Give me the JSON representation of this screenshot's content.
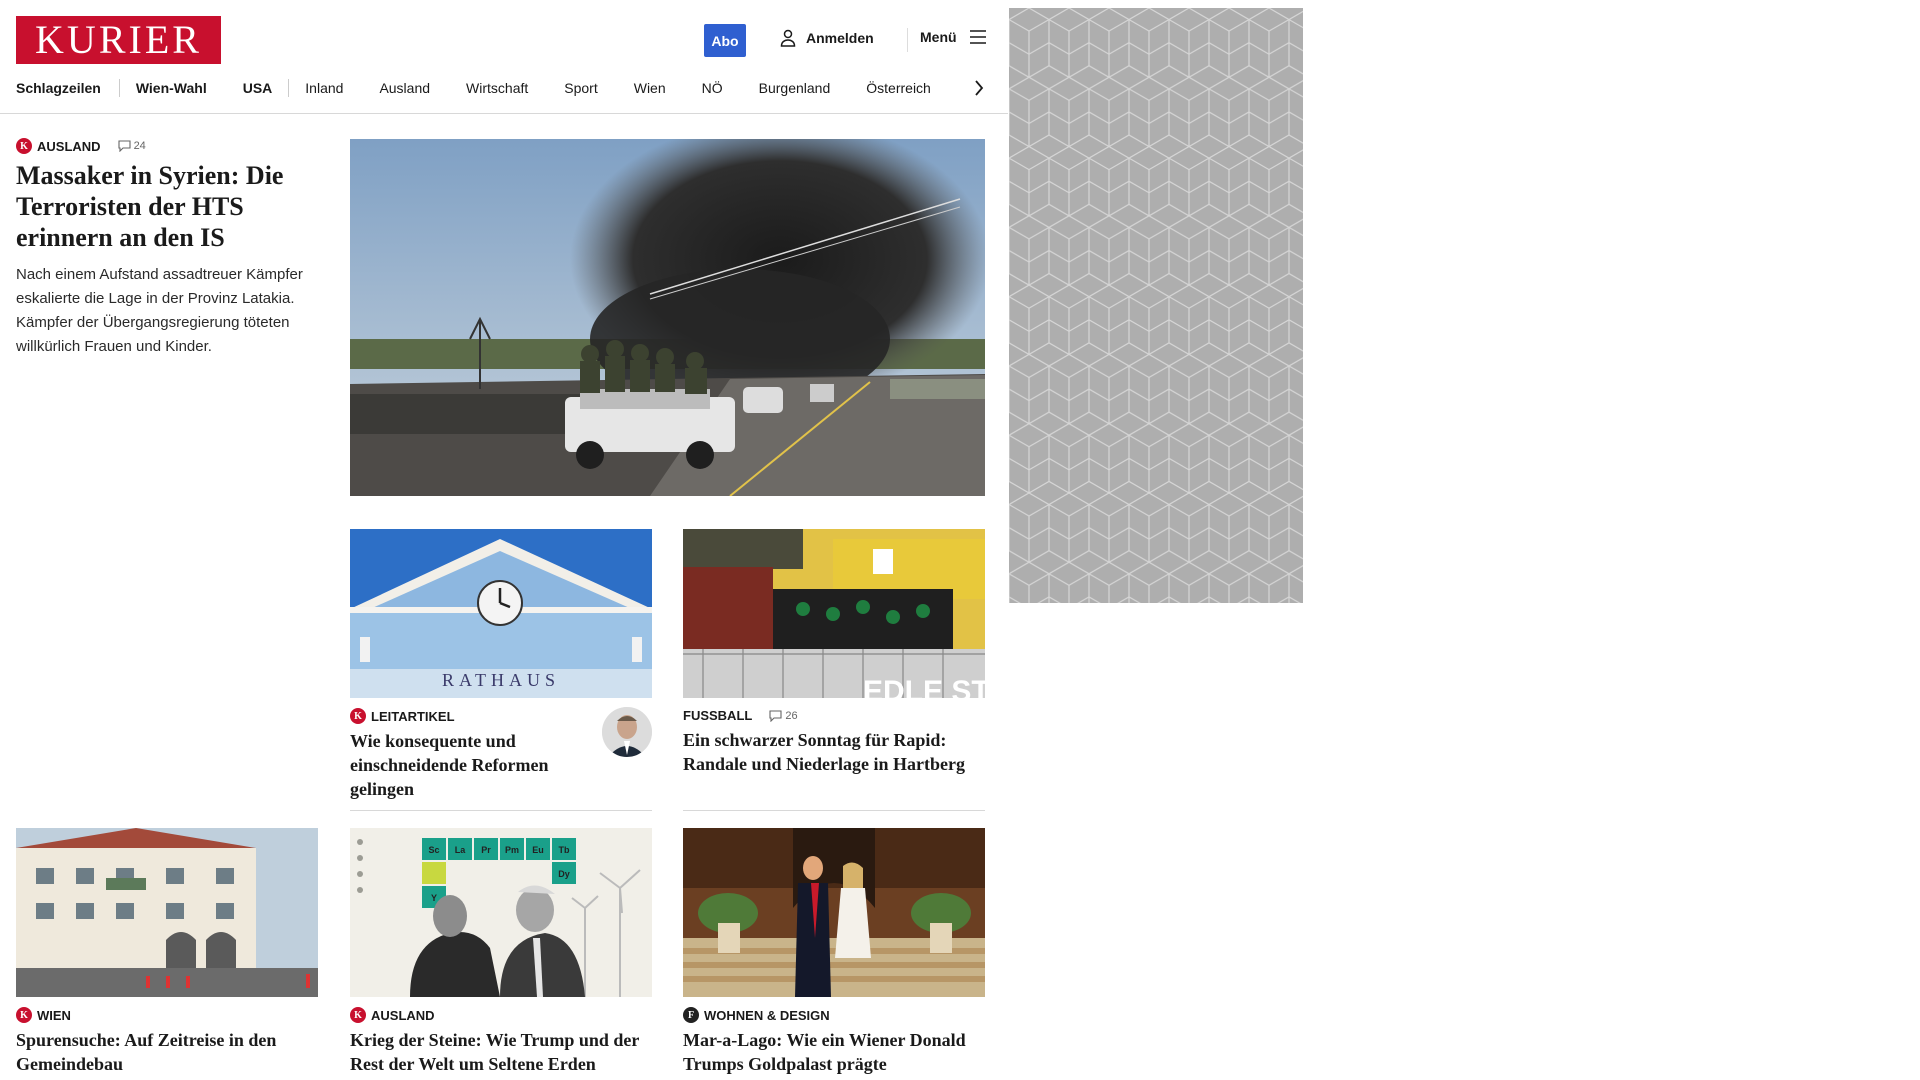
{
  "header": {
    "logo": "KURIER",
    "abo_label": "Abo",
    "login_label": "Anmelden",
    "menu_label": "Menü"
  },
  "nav": {
    "items": [
      "Schlagzeilen",
      "Wien-Wahl",
      "USA",
      "Inland",
      "Ausland",
      "Wirtschaft",
      "Sport",
      "Wien",
      "NÖ",
      "Burgenland",
      "Österreich"
    ]
  },
  "lead": {
    "category": "AUSLAND",
    "comments": "24",
    "headline": "Massaker in Syrien: Die Terroristen der HTS erinnern an den IS",
    "teaser": "Nach einem Aufstand assadtreuer Kämpfer eskalierte die Lage in der Provinz Latakia. Kämpfer der Übergangsregierung töteten willkürlich Frauen und Kinder."
  },
  "cards": [
    {
      "category": "LEITARTIKEL",
      "headline": "Wie konsequente und einschneidende Reformen gelingen",
      "image_text": "RATHAUS"
    },
    {
      "category": "FUSSBALL",
      "comments": "26",
      "headline": "Ein schwarzer Sonntag für Rapid: Randale und Niederlage in Hartberg",
      "image_text": "EDLE ST"
    },
    {
      "category": "WIEN",
      "headline": "Spurensuche: Auf Zeitreise in den Gemeindebau"
    },
    {
      "category": "AUSLAND",
      "headline": "Krieg der Steine: Wie Trump und der Rest der Welt um Seltene Erden kämpfen",
      "elements": [
        "Sc",
        "La",
        "Pr",
        "Pm",
        "Eu",
        "Tb",
        "Y",
        "Dy"
      ]
    },
    {
      "category": "WOHNEN & DESIGN",
      "headline": "Mar-a-Lago: Wie ein Wiener Donald Trumps Goldpalast prägte"
    }
  ],
  "colors": {
    "brand": "#c8102e",
    "abo": "#2f5fd0",
    "ad_bg": "#aeaeae"
  }
}
